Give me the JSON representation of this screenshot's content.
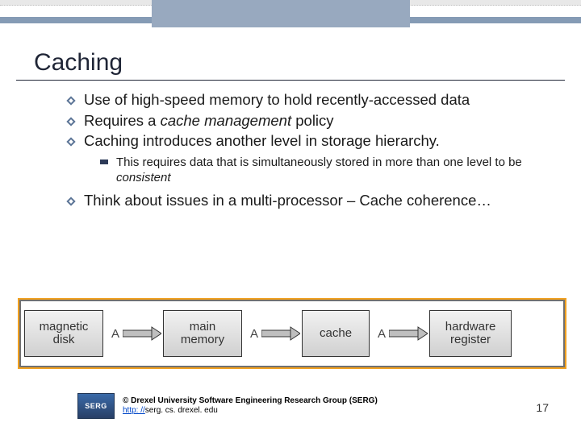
{
  "slide": {
    "title": "Caching",
    "bullets": [
      {
        "text": "Use of high-speed memory to hold recently-accessed data"
      },
      {
        "prefix": "Requires a ",
        "em": "cache management",
        "suffix": " policy"
      },
      {
        "text": "Caching introduces another level in storage hierarchy."
      },
      {
        "text": "Think about issues in a multi-processor – Cache coherence…"
      }
    ],
    "subpoint": {
      "prefix": "This requires data that is simultaneously stored in more than one level to be ",
      "em": "consistent"
    }
  },
  "diagram": {
    "nodes": [
      "magnetic disk",
      "main memory",
      "cache",
      "hardware register"
    ],
    "arrow_label": "A"
  },
  "footer": {
    "logo_text": "SERG",
    "copyright": "© Drexel University Software Engineering Research Group (SERG)",
    "link_prefix": "http: //",
    "link_rest": "serg. cs. drexel. edu"
  },
  "page_number": "17"
}
